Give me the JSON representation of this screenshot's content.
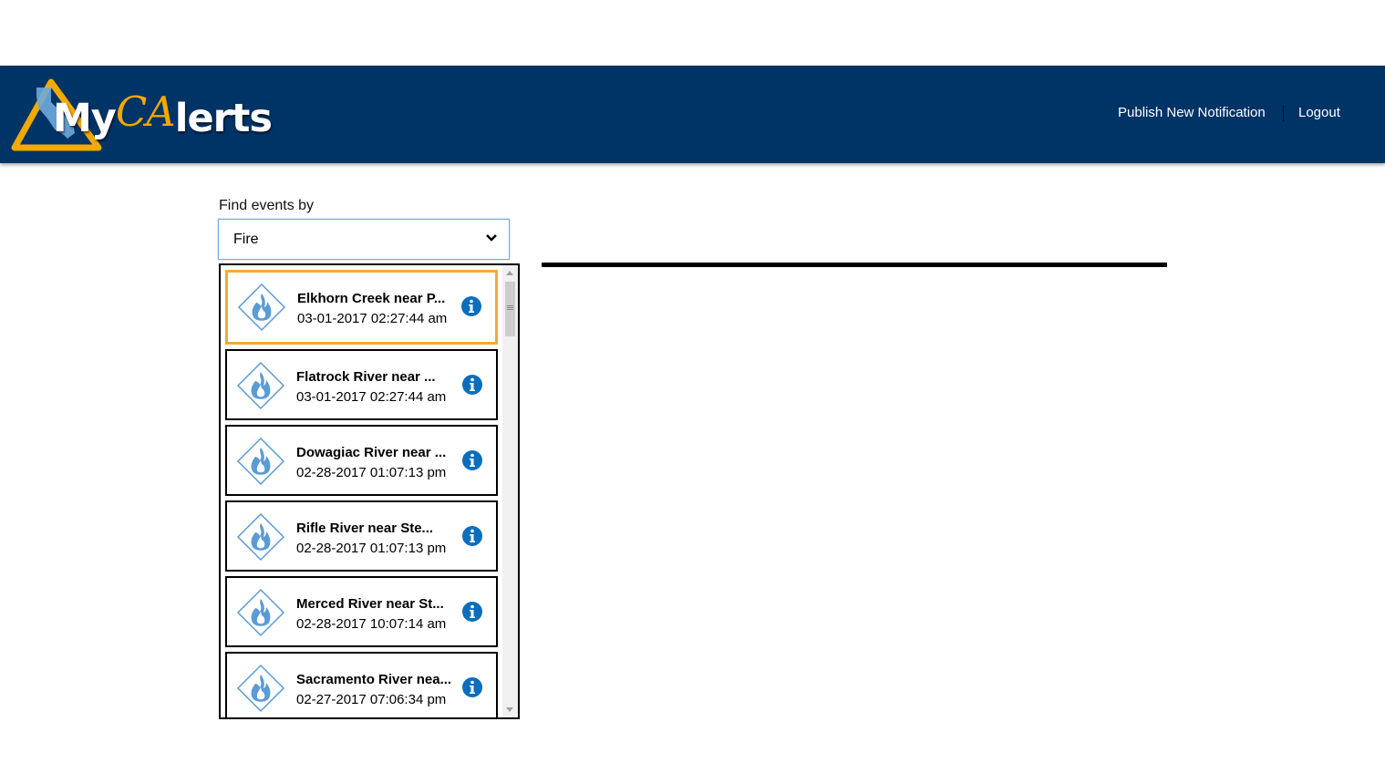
{
  "header": {
    "logo": {
      "my": "My",
      "ca": "CA",
      "lerts": "lerts"
    },
    "nav": {
      "publish_label": "Publish New Notification",
      "logout_label": "Logout"
    },
    "colors": {
      "bar": "#003366",
      "accent": "#f2a900"
    }
  },
  "filter": {
    "label": "Find events by",
    "selected": "Fire"
  },
  "events": [
    {
      "title": "Elkhorn Creek near P...",
      "time": "03-01-2017 02:27:44 am",
      "icon": "fire-icon",
      "selected": true
    },
    {
      "title": "Flatrock River near ...",
      "time": "03-01-2017 02:27:44 am",
      "icon": "fire-icon",
      "selected": false
    },
    {
      "title": "Dowagiac River near ...",
      "time": "02-28-2017 01:07:13 pm",
      "icon": "fire-icon",
      "selected": false
    },
    {
      "title": "Rifle River near Ste...",
      "time": "02-28-2017 01:07:13 pm",
      "icon": "fire-icon",
      "selected": false
    },
    {
      "title": "Merced River near St...",
      "time": "02-28-2017 10:07:14 am",
      "icon": "fire-icon",
      "selected": false
    },
    {
      "title": "Sacramento River nea...",
      "time": "02-27-2017 07:06:34 pm",
      "icon": "fire-icon",
      "selected": false
    }
  ]
}
